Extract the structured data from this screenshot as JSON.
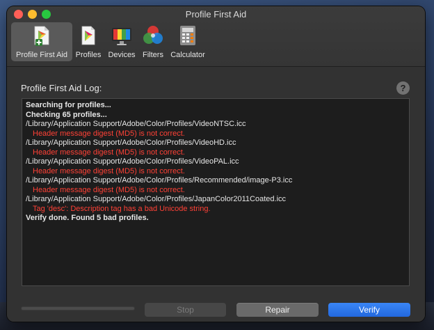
{
  "window": {
    "title": "Profile First Aid"
  },
  "toolbar": {
    "items": [
      {
        "label": "Profile First Aid",
        "icon": "profile-first-aid-icon",
        "active": true
      },
      {
        "label": "Profiles",
        "icon": "profiles-icon",
        "active": false
      },
      {
        "label": "Devices",
        "icon": "devices-icon",
        "active": false
      },
      {
        "label": "Filters",
        "icon": "filters-icon",
        "active": false
      },
      {
        "label": "Calculator",
        "icon": "calculator-icon",
        "active": false
      }
    ]
  },
  "log": {
    "title": "Profile First Aid Log:",
    "help": "?",
    "lines": [
      {
        "text": "Searching for profiles...",
        "kind": "bold"
      },
      {
        "text": "Checking 65 profiles...",
        "kind": "bold"
      },
      {
        "text": "/Library/Application Support/Adobe/Color/Profiles/VideoNTSC.icc",
        "kind": "path"
      },
      {
        "text": "Header message digest (MD5) is not correct.",
        "kind": "error"
      },
      {
        "text": "/Library/Application Support/Adobe/Color/Profiles/VideoHD.icc",
        "kind": "path"
      },
      {
        "text": "Header message digest (MD5) is not correct.",
        "kind": "error"
      },
      {
        "text": "/Library/Application Support/Adobe/Color/Profiles/VideoPAL.icc",
        "kind": "path"
      },
      {
        "text": "Header message digest (MD5) is not correct.",
        "kind": "error"
      },
      {
        "text": "/Library/Application Support/Adobe/Color/Profiles/Recommended/image-P3.icc",
        "kind": "path"
      },
      {
        "text": "Header message digest (MD5) is not correct.",
        "kind": "error"
      },
      {
        "text": "/Library/Application Support/Adobe/Color/Profiles/JapanColor2011Coated.icc",
        "kind": "path"
      },
      {
        "text": "Tag 'desc': Description tag has a bad Unicode string.",
        "kind": "error"
      },
      {
        "text": "Verify done. Found 5 bad profiles.",
        "kind": "bold"
      }
    ]
  },
  "progress": {
    "value": 0
  },
  "buttons": {
    "stop": "Stop",
    "repair": "Repair",
    "verify": "Verify"
  },
  "colors": {
    "error": "#ff4136",
    "accent": "#2a75ee"
  }
}
